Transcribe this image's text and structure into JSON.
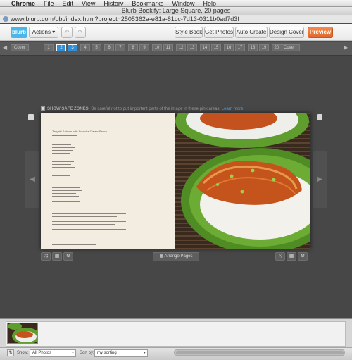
{
  "menubar": {
    "apple": "",
    "items": [
      "Chrome",
      "File",
      "Edit",
      "View",
      "History",
      "Bookmarks",
      "Window",
      "Help"
    ]
  },
  "window": {
    "title": "Blurb Bookify: Large Square, 20 pages"
  },
  "browser": {
    "url": "www.blurb.com/obt/index.html?project=2505362a-e81a-81cc-7d13-0311b0ad7d3f"
  },
  "toolbar": {
    "logo": "blurb",
    "actions": "Actions ▾",
    "undo": "↶",
    "redo": "↷",
    "style_book": "Style Book",
    "get_photos": "Get Photos",
    "auto_create": "Auto Create",
    "design_cover": "Design Cover",
    "preview": "Preview"
  },
  "pagestrip": {
    "left_arrow": "◀",
    "right_arrow": "▶",
    "cover_left": "Cover",
    "cover_right": "Cover",
    "pages": [
      "1",
      "2",
      "3",
      "4",
      "5",
      "6",
      "7",
      "8",
      "9",
      "10",
      "11",
      "12",
      "13",
      "14",
      "15",
      "16",
      "17",
      "18",
      "19",
      "20"
    ],
    "selected": [
      "2",
      "3"
    ]
  },
  "canvas": {
    "safe_zone_label": "SHOW SAFE ZONES:",
    "safe_zone_text": "Be careful not to put important parts of the image in these pink areas.",
    "safe_zone_link": "Learn more",
    "left_nav": "◀",
    "right_nav": "▶",
    "arrange_pages": "Arrange Pages",
    "left_page_title": "Teriyaki Salmon with Sriracha Cream Sauce"
  },
  "tray": {
    "show_label": "Show:",
    "show_value": "All Photos",
    "sort_label": "Sort by:",
    "sort_value": "my sorting"
  },
  "colors": {
    "accent": "#2f8fd8",
    "preview": "#e0662a",
    "logo": "#4db6e8"
  }
}
